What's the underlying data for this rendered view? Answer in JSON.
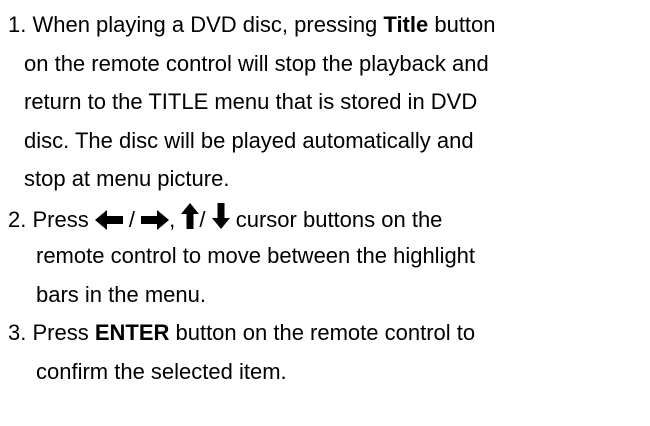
{
  "instructions": {
    "step1": {
      "line1_prefix": "1. When playing a DVD disc, pressing ",
      "line1_bold": "Title",
      "line1_suffix": " button",
      "line2": "on the remote control will stop the playback and",
      "line3": "return to the TITLE menu that is stored in DVD",
      "line4": "disc. The disc will be played automatically and",
      "line5": "stop at menu picture."
    },
    "step2": {
      "prefix": "2. Press ",
      "sep1": " / ",
      "sep2": ", ",
      "sep3": "/ ",
      "suffix": " cursor buttons on the",
      "line2": "remote control to move between the highlight",
      "line3": "bars in the menu.",
      "icons": [
        "left-arrow-icon",
        "right-arrow-icon",
        "up-arrow-icon",
        "down-arrow-icon"
      ]
    },
    "step3": {
      "prefix": "3. Press ",
      "bold": "ENTER",
      "suffix": " button on the remote control to",
      "line2": "confirm the selected item."
    }
  }
}
